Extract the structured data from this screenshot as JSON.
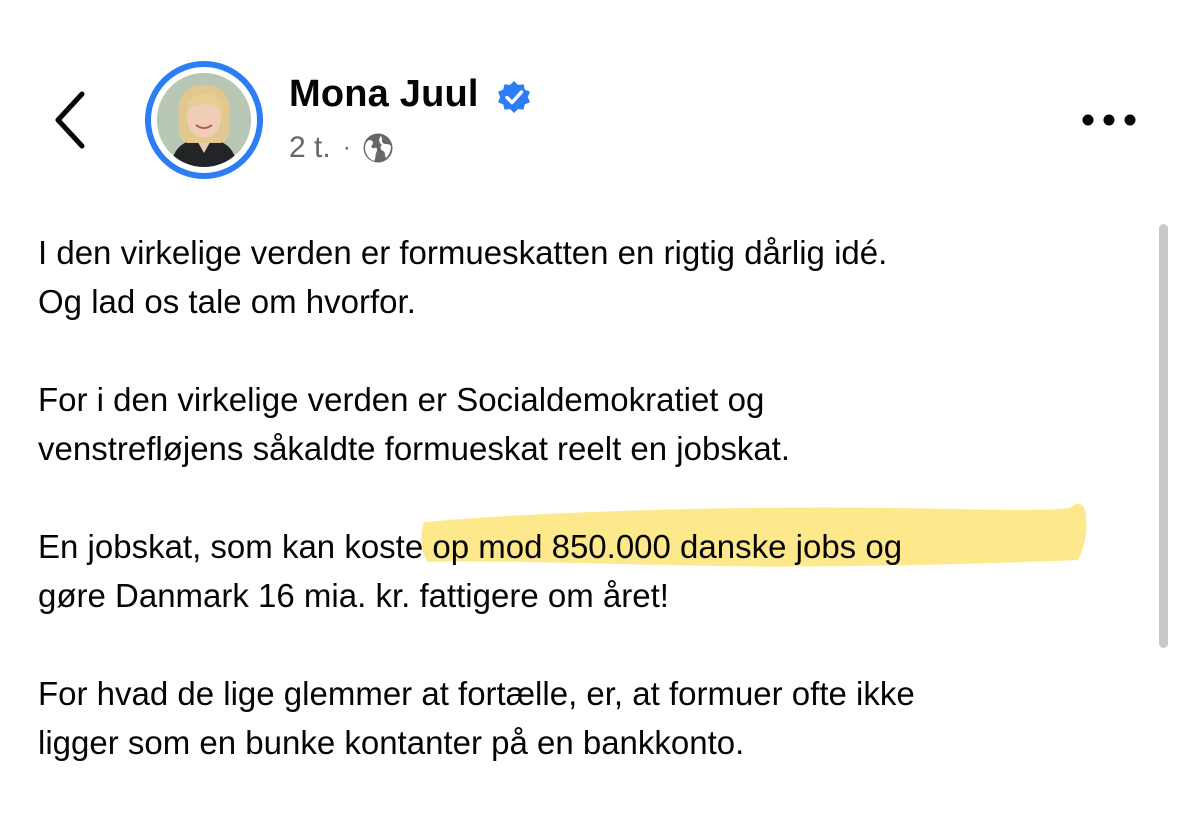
{
  "header": {
    "author_name": "Mona Juul",
    "verified": true,
    "timestamp": "2 t.",
    "separator": "·",
    "audience_icon": "globe-icon",
    "back_icon": "chevron-left-icon",
    "more_icon": "more-horizontal-icon"
  },
  "post": {
    "paragraphs": [
      {
        "lines": [
          "I den virkelige verden er formueskatten en rigtig dårlig idé.",
          "Og lad os tale om hvorfor."
        ]
      },
      {
        "lines": [
          "For i den virkelige verden er Socialdemokratiet og",
          "venstrefløjens såkaldte formueskat reelt en jobskat."
        ]
      },
      {
        "lines": [
          "En jobskat, som kan koste op mod 850.000 danske jobs og",
          "gøre Danmark 16 mia. kr. fattigere om året!"
        ],
        "highlighted_text": "koste op mod 850.000 danske jobs og"
      },
      {
        "lines": [
          "For hvad de lige glemmer at fortælle, er, at formuer ofte ikke",
          "ligger som en bunke kontanter på en bankkonto."
        ]
      }
    ]
  },
  "colors": {
    "accent_blue": "#2d7df6",
    "meta_gray": "#65676b",
    "highlight_yellow": "#fde36b",
    "text": "#050505"
  }
}
